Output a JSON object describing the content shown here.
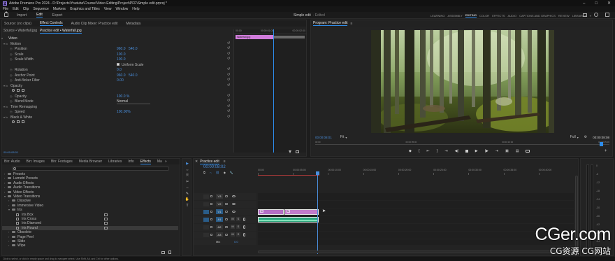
{
  "titlebar": {
    "app_logo": "Pr",
    "title": "Adobe Premiere Pro 2024 - D:\\Projects\\Youtube\\Course\\Video Editing\\Project\\PFF\\Simple edit.prproj *",
    "controls": [
      "–",
      "□",
      "✕"
    ]
  },
  "menubar": {
    "items": [
      "File",
      "Edit",
      "Clip",
      "Sequence",
      "Markers",
      "Graphics and Titles",
      "View",
      "Window",
      "Help"
    ]
  },
  "header": {
    "home_icon": "home-icon",
    "tabs": [
      "Import",
      "Edit",
      "Export"
    ],
    "active_tab": "Edit",
    "project_name": "Simple edit",
    "project_status": "- Edited",
    "workspaces": [
      "LEARNING",
      "ASSEMBLY",
      "EDITING",
      "COLOR",
      "EFFECTS",
      "AUDIO",
      "CAPTIONS AND GRAPHICS",
      "REVIEW",
      "LIBRARIES"
    ],
    "active_workspace": "EDITING"
  },
  "source_panel": {
    "tabs": [
      "Source: (no clips)",
      "Effect Controls",
      "Audio Clip Mixer: Practice edit",
      "Metadata"
    ],
    "active_tab": "Effect Controls",
    "clip_tabs": [
      "Source • Waterfall.jpg",
      "Practice edit • Waterfall.jpg"
    ],
    "ruler": [
      "00:00",
      "00:00:01:00",
      "00:00:02:00"
    ],
    "clip_name": "Waterfall.jpg",
    "properties": [
      {
        "label": "Video",
        "value": "",
        "value2": "",
        "level": 0
      },
      {
        "label": "Motion",
        "value": "",
        "value2": "",
        "level": 1
      },
      {
        "label": "Position",
        "value": "960.0",
        "value2": "540.0",
        "level": 2
      },
      {
        "label": "Scale",
        "value": "100.0",
        "value2": "",
        "level": 2
      },
      {
        "label": "Scale Width",
        "value": "100.0",
        "value2": "",
        "level": 2
      },
      {
        "label": "",
        "value": "Uniform Scale",
        "value2": "",
        "level": 3
      },
      {
        "label": "Rotation",
        "value": "0.0",
        "value2": "",
        "level": 2
      },
      {
        "label": "Anchor Point",
        "value": "960.0",
        "value2": "540.0",
        "level": 2
      },
      {
        "label": "Anti-flicker Filter",
        "value": "0.00",
        "value2": "",
        "level": 2
      },
      {
        "label": "Opacity",
        "value": "",
        "value2": "",
        "level": 1
      },
      {
        "label": "",
        "value": "",
        "value2": "",
        "level": 9
      },
      {
        "label": "Opacity",
        "value": "100.0 %",
        "value2": "",
        "level": 2
      },
      {
        "label": "Blend Mode",
        "value": "Normal",
        "value2": "",
        "level": 2
      },
      {
        "label": "Time Remapping",
        "value": "",
        "value2": "",
        "level": 1
      },
      {
        "label": "Speed",
        "value": "100.00%",
        "value2": "",
        "level": 2
      },
      {
        "label": "Black & White",
        "value": "",
        "value2": "",
        "level": 1
      },
      {
        "label": "",
        "value": "",
        "value2": "",
        "level": 9
      }
    ],
    "timecode": "00:00:08:01"
  },
  "program_panel": {
    "title": "Program: Practice edit",
    "menu_icon": "≡",
    "timecode": "00:00:08:01",
    "fit": "Fit",
    "quality": "Full",
    "duration": "00:00:08:08",
    "ruler_labels": [
      "00:00",
      "00:00:05:00",
      "00:00:10:00",
      "00:00:15:00"
    ],
    "controls": [
      "◆",
      "{",
      "⇤",
      "}",
      "⇥",
      "◀|",
      "◀",
      "▶",
      "|▶",
      "⇥",
      "▣",
      "▤",
      "📷"
    ]
  },
  "project_panel": {
    "tabs": [
      "Bin: Audio",
      "Bin: Images",
      "Bin: Footages",
      "Media Browser",
      "Libraries",
      "Info",
      "Effects",
      "Ma"
    ],
    "active_tab": "Effects",
    "search": "",
    "tree": [
      {
        "label": "Presets",
        "level": 0
      },
      {
        "label": "Lumetri Presets",
        "level": 0
      },
      {
        "label": "Audio Effects",
        "level": 0
      },
      {
        "label": "Audio Transitions",
        "level": 0
      },
      {
        "label": "Video Effects",
        "level": 0
      },
      {
        "label": "Video Transitions",
        "level": 0
      },
      {
        "label": "Dissolve",
        "level": 1
      },
      {
        "label": "Immersive Video",
        "level": 1
      },
      {
        "label": "Iris",
        "level": 1
      },
      {
        "label": "Iris Box",
        "level": 2
      },
      {
        "label": "Iris Cross",
        "level": 2
      },
      {
        "label": "Iris Diamond",
        "level": 2
      },
      {
        "label": "Iris Round",
        "level": 2
      },
      {
        "label": "Obsolete",
        "level": 1
      },
      {
        "label": "Page Peel",
        "level": 1
      },
      {
        "label": "Slide",
        "level": 1
      },
      {
        "label": "Wipe",
        "level": 1
      }
    ]
  },
  "timeline": {
    "title": "Practice edit",
    "timecode": "00:00:08:02",
    "ruler": [
      "00:00",
      "00:00:05:00",
      "00:00:10:00",
      "00:00:15:00",
      "00:00:20:00",
      "00:00:25:00",
      "00:00:30:00",
      "00:00:35:00",
      "00:00:40:00"
    ],
    "tracks": [
      {
        "name": "V3",
        "type": "video"
      },
      {
        "name": "V2",
        "type": "video"
      },
      {
        "name": "V1",
        "type": "video"
      },
      {
        "name": "A1",
        "type": "audio"
      },
      {
        "name": "A2",
        "type": "audio"
      },
      {
        "name": "A3",
        "type": "audio"
      },
      {
        "name": "Mix",
        "value": "0.0",
        "type": "mix"
      }
    ],
    "clips": [
      {
        "label": "fx",
        "track": "V1",
        "start": 0.0,
        "end": 0.43,
        "color": "#b46fc4"
      },
      {
        "label": "fx",
        "track": "V1",
        "start": 0.43,
        "end": 1.0,
        "color": "#c27cca"
      },
      {
        "label": "",
        "track": "A1",
        "start": 0.0,
        "end": 1.0,
        "color": "#2aa47b"
      }
    ],
    "tools": [
      "▶",
      "⇔",
      "⤧",
      "✂",
      "↔",
      "✎",
      "✋",
      "T"
    ]
  },
  "meters": {
    "labels": [
      "0",
      "-6",
      "-12",
      "-18",
      "-24",
      "-30",
      "-36",
      "-42",
      "-48",
      "-54",
      "dB"
    ]
  },
  "statusbar": {
    "text": "Click to select, or click in empty space and drag to marquee select. Use Shift, Alt, and Ctrl for other options."
  },
  "watermark": {
    "line1": "CGer.com",
    "line2": "CG资源 CG网站"
  },
  "colors": {
    "accent": "#2d8ceb",
    "timecode": "#4a8fdd",
    "video_clip": "#c27cca",
    "audio_clip": "#2aa47b",
    "selected_track": "#2a5c88"
  }
}
